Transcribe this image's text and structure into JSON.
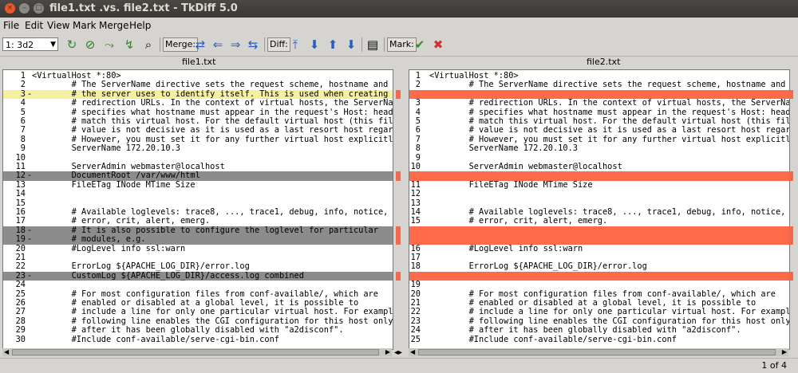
{
  "window": {
    "title": "file1.txt .vs. file2.txt - TkDiff 5.0"
  },
  "menu": [
    "File",
    "Edit",
    "View",
    "Mark",
    "Merge",
    "Help"
  ],
  "toolbar": {
    "diff_selector": "1: 3d2",
    "merge_label": "Merge:",
    "diff_label": "Diff:",
    "mark_label": "Mark:"
  },
  "files": {
    "left": "file1.txt",
    "right": "file2.txt"
  },
  "left_lines": [
    {
      "n": "1",
      "m": "",
      "t": "<VirtualHost *:80>",
      "h": ""
    },
    {
      "n": "2",
      "m": "",
      "t": "        # The ServerName directive sets the request scheme, hostname and port that",
      "h": ""
    },
    {
      "n": "3",
      "m": "-",
      "t": "        # the server uses to identify itself. This is used when creating",
      "h": "yellow"
    },
    {
      "n": "4",
      "m": "",
      "t": "        # redirection URLs. In the context of virtual hosts, the ServerName",
      "h": ""
    },
    {
      "n": "5",
      "m": "",
      "t": "        # specifies what hostname must appear in the request's Host: header to",
      "h": ""
    },
    {
      "n": "6",
      "m": "",
      "t": "        # match this virtual host. For the default virtual host (this file) this",
      "h": ""
    },
    {
      "n": "7",
      "m": "",
      "t": "        # value is not decisive as it is used as a last resort host regardless.",
      "h": ""
    },
    {
      "n": "8",
      "m": "",
      "t": "        # However, you must set it for any further virtual host explicitly.",
      "h": ""
    },
    {
      "n": "9",
      "m": "",
      "t": "        ServerName 172.20.10.3",
      "h": ""
    },
    {
      "n": "10",
      "m": "",
      "t": "",
      "h": ""
    },
    {
      "n": "11",
      "m": "",
      "t": "        ServerAdmin webmaster@localhost",
      "h": ""
    },
    {
      "n": "12",
      "m": "-",
      "t": "        DocumentRoot /var/www/html",
      "h": "gray"
    },
    {
      "n": "13",
      "m": "",
      "t": "        FileETag INode MTime Size",
      "h": ""
    },
    {
      "n": "14",
      "m": "",
      "t": "",
      "h": ""
    },
    {
      "n": "15",
      "m": "",
      "t": "",
      "h": ""
    },
    {
      "n": "16",
      "m": "",
      "t": "        # Available loglevels: trace8, ..., trace1, debug, info, notice, warn,",
      "h": ""
    },
    {
      "n": "17",
      "m": "",
      "t": "        # error, crit, alert, emerg.",
      "h": ""
    },
    {
      "n": "18",
      "m": "-",
      "t": "        # It is also possible to configure the loglevel for particular",
      "h": "gray"
    },
    {
      "n": "19",
      "m": "-",
      "t": "        # modules, e.g.",
      "h": "gray"
    },
    {
      "n": "20",
      "m": "",
      "t": "        #LogLevel info ssl:warn",
      "h": ""
    },
    {
      "n": "21",
      "m": "",
      "t": "",
      "h": ""
    },
    {
      "n": "22",
      "m": "",
      "t": "        ErrorLog ${APACHE_LOG_DIR}/error.log",
      "h": ""
    },
    {
      "n": "23",
      "m": "-",
      "t": "        CustomLog ${APACHE_LOG_DIR}/access.log combined",
      "h": "gray"
    },
    {
      "n": "24",
      "m": "",
      "t": "",
      "h": ""
    },
    {
      "n": "25",
      "m": "",
      "t": "        # For most configuration files from conf-available/, which are",
      "h": ""
    },
    {
      "n": "26",
      "m": "",
      "t": "        # enabled or disabled at a global level, it is possible to",
      "h": ""
    },
    {
      "n": "27",
      "m": "",
      "t": "        # include a line for only one particular virtual host. For example the",
      "h": ""
    },
    {
      "n": "28",
      "m": "",
      "t": "        # following line enables the CGI configuration for this host only",
      "h": ""
    },
    {
      "n": "29",
      "m": "",
      "t": "        # after it has been globally disabled with \"a2disconf\".",
      "h": ""
    },
    {
      "n": "30",
      "m": "",
      "t": "        #Include conf-available/serve-cgi-bin.conf",
      "h": ""
    }
  ],
  "right_lines": [
    {
      "n": "1",
      "t": "<VirtualHost *:80>",
      "h": ""
    },
    {
      "n": "2",
      "t": "        # The ServerName directive sets the request scheme, hostname and port that",
      "h": ""
    },
    {
      "n": "",
      "t": "",
      "h": "red"
    },
    {
      "n": "3",
      "t": "        # redirection URLs. In the context of virtual hosts, the ServerName",
      "h": ""
    },
    {
      "n": "4",
      "t": "        # specifies what hostname must appear in the request's Host: header to",
      "h": ""
    },
    {
      "n": "5",
      "t": "        # match this virtual host. For the default virtual host (this file) this",
      "h": ""
    },
    {
      "n": "6",
      "t": "        # value is not decisive as it is used as a last resort host regardless.",
      "h": ""
    },
    {
      "n": "7",
      "t": "        # However, you must set it for any further virtual host explicitly.",
      "h": ""
    },
    {
      "n": "8",
      "t": "        ServerName 172.20.10.3",
      "h": ""
    },
    {
      "n": "9",
      "t": "",
      "h": ""
    },
    {
      "n": "10",
      "t": "        ServerAdmin webmaster@localhost",
      "h": ""
    },
    {
      "n": "",
      "t": "",
      "h": "red"
    },
    {
      "n": "11",
      "t": "        FileETag INode MTime Size",
      "h": ""
    },
    {
      "n": "12",
      "t": "",
      "h": ""
    },
    {
      "n": "13",
      "t": "",
      "h": ""
    },
    {
      "n": "14",
      "t": "        # Available loglevels: trace8, ..., trace1, debug, info, notice, warn,",
      "h": ""
    },
    {
      "n": "15",
      "t": "        # error, crit, alert, emerg.",
      "h": ""
    },
    {
      "n": "",
      "t": "",
      "h": "red"
    },
    {
      "n": "",
      "t": "",
      "h": "red"
    },
    {
      "n": "16",
      "t": "        #LogLevel info ssl:warn",
      "h": ""
    },
    {
      "n": "17",
      "t": "",
      "h": ""
    },
    {
      "n": "18",
      "t": "        ErrorLog ${APACHE_LOG_DIR}/error.log",
      "h": ""
    },
    {
      "n": "",
      "t": "",
      "h": "red"
    },
    {
      "n": "19",
      "t": "",
      "h": ""
    },
    {
      "n": "20",
      "t": "        # For most configuration files from conf-available/, which are",
      "h": ""
    },
    {
      "n": "21",
      "t": "        # enabled or disabled at a global level, it is possible to",
      "h": ""
    },
    {
      "n": "22",
      "t": "        # include a line for only one particular virtual host. For example the",
      "h": ""
    },
    {
      "n": "23",
      "t": "        # following line enables the CGI configuration for this host only",
      "h": ""
    },
    {
      "n": "24",
      "t": "        # after it has been globally disabled with \"a2disconf\".",
      "h": ""
    },
    {
      "n": "25",
      "t": "        #Include conf-available/serve-cgi-bin.conf",
      "h": ""
    }
  ],
  "status": {
    "count": "1 of 4"
  }
}
